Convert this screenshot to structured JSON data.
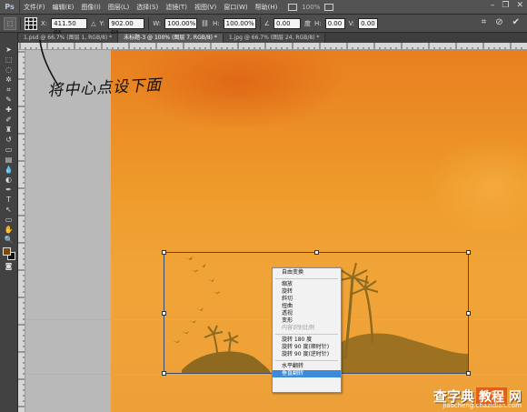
{
  "app": {
    "logo": "Ps"
  },
  "menubar": {
    "items": [
      "文件(F)",
      "编辑(E)",
      "图像(I)",
      "图层(L)",
      "选择(S)",
      "滤镜(T)",
      "视图(V)",
      "窗口(W)",
      "帮助(H)"
    ],
    "zoom": "100%"
  },
  "options": {
    "x_label": "X:",
    "x_value": "411.50 px",
    "y_label": "Y:",
    "y_value": "902.00 px",
    "w_label": "W:",
    "w_value": "100.00%",
    "h_label": "H:",
    "h_value": "100.00%",
    "angle_value": "0.00",
    "hskew_label": "H:",
    "hskew_value": "0.00",
    "vskew_label": "V:",
    "vskew_value": "0.00"
  },
  "tabs": [
    "1.psd @ 66.7% (图层 1, RGB/8) *",
    "未标题-3 @ 100% (图层 7, RGB/8) *",
    "1.jpg @ 66.7% (图层 24, RGB/8) *"
  ],
  "annotation": {
    "text": "将中心点设下面"
  },
  "context_menu": {
    "items": [
      {
        "label": "自由变换",
        "state": "normal"
      },
      {
        "sep": true
      },
      {
        "label": "缩放",
        "state": "normal"
      },
      {
        "label": "旋转",
        "state": "normal"
      },
      {
        "label": "斜切",
        "state": "normal"
      },
      {
        "label": "扭曲",
        "state": "normal"
      },
      {
        "label": "透视",
        "state": "normal"
      },
      {
        "label": "变形",
        "state": "normal"
      },
      {
        "label": "内容识别比例",
        "state": "disabled"
      },
      {
        "sep": true
      },
      {
        "label": "旋转 180 度",
        "state": "normal"
      },
      {
        "label": "旋转 90 度(顺时针)",
        "state": "normal"
      },
      {
        "label": "旋转 90 度(逆时针)",
        "state": "normal"
      },
      {
        "sep": true
      },
      {
        "label": "水平翻转",
        "state": "normal"
      },
      {
        "label": "垂直翻转",
        "state": "selected"
      }
    ]
  },
  "watermark": {
    "part1": "查字典",
    "part2": "教程",
    "part3": "网",
    "url": "jiaocheng.chazidian.com"
  },
  "colors": {
    "accent": "#3b8bd9",
    "canvas_orange": "#ee9a2b",
    "guide": "#59d2ec"
  }
}
